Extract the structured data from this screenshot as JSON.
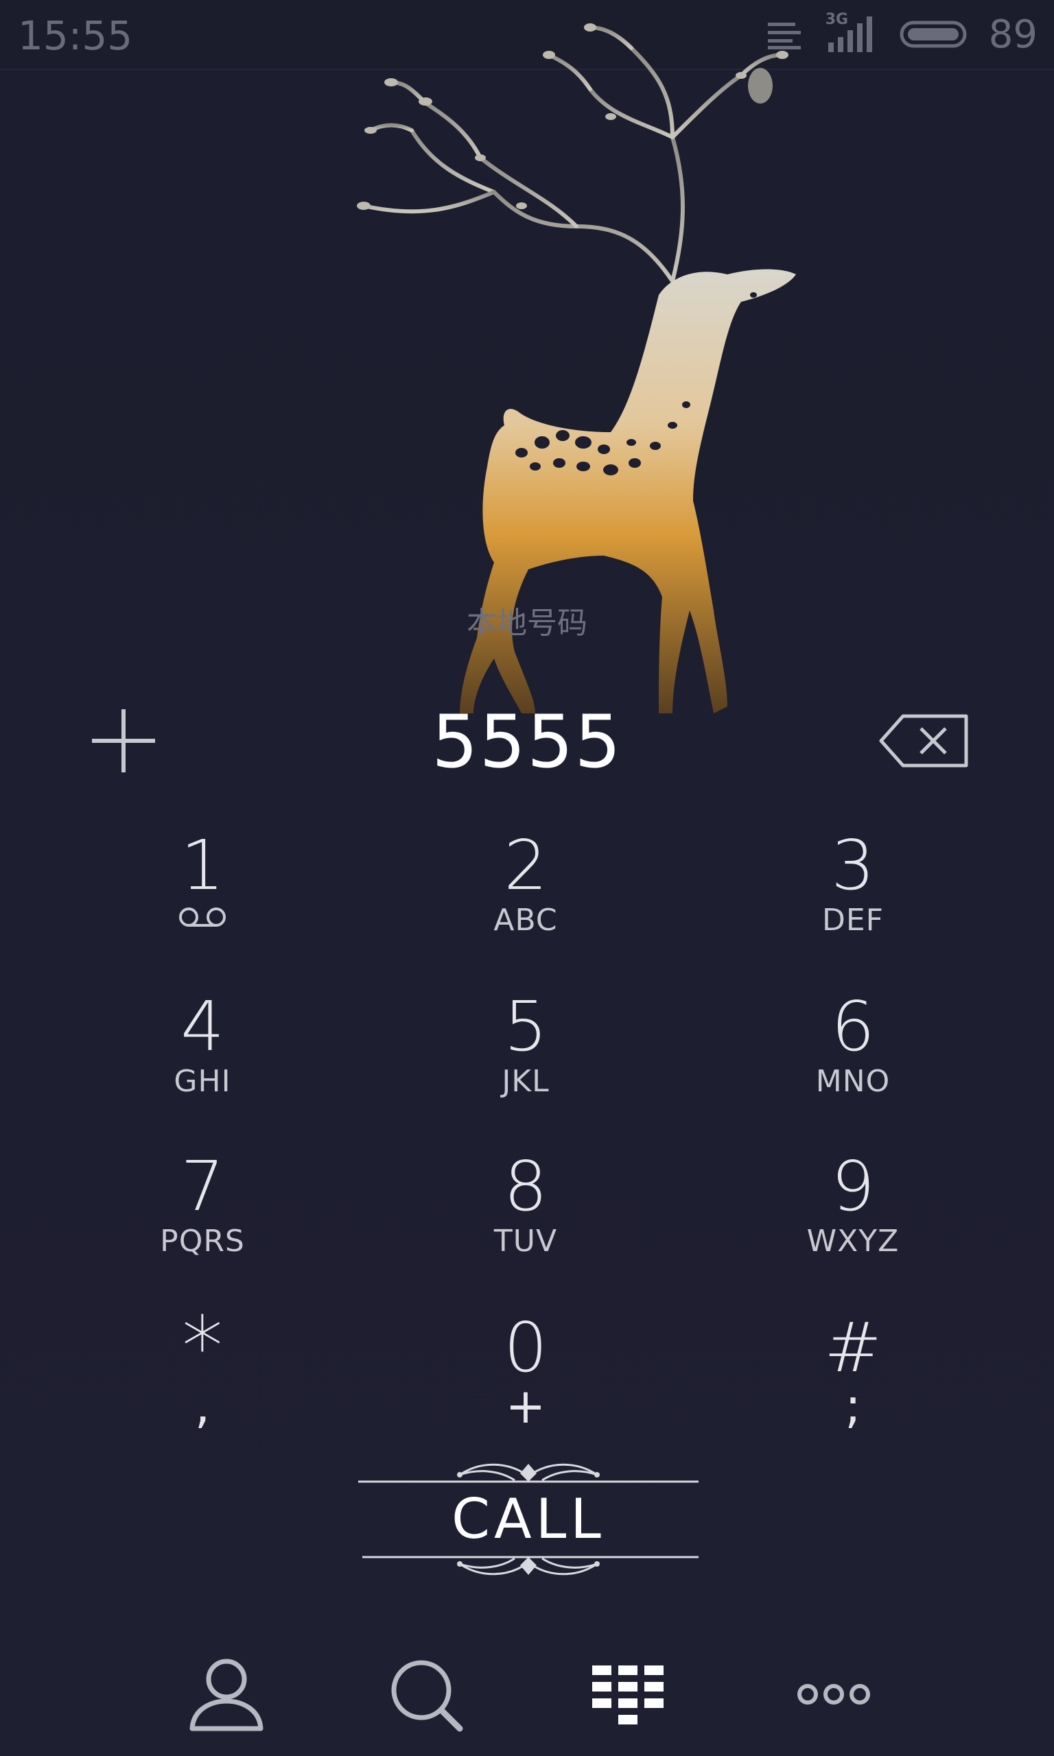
{
  "status_bar": {
    "time": "15:55",
    "network": "3G",
    "battery": "89"
  },
  "dialer": {
    "caller_location": "本地号码",
    "number": "5555"
  },
  "keypad": [
    {
      "digit": "1",
      "letters": "",
      "sub_icon": "voicemail-icon"
    },
    {
      "digit": "2",
      "letters": "ABC"
    },
    {
      "digit": "3",
      "letters": "DEF"
    },
    {
      "digit": "4",
      "letters": "GHI"
    },
    {
      "digit": "5",
      "letters": "JKL"
    },
    {
      "digit": "6",
      "letters": "MNO"
    },
    {
      "digit": "7",
      "letters": "PQRS"
    },
    {
      "digit": "8",
      "letters": "TUV"
    },
    {
      "digit": "9",
      "letters": "WXYZ"
    },
    {
      "digit": "*",
      "letters": ","
    },
    {
      "digit": "0",
      "letters": "+"
    },
    {
      "digit": "#",
      "letters": ";"
    }
  ],
  "call_button": {
    "label": "CALL"
  },
  "bottom_nav": [
    {
      "icon": "contacts-icon"
    },
    {
      "icon": "search-icon"
    },
    {
      "icon": "dialpad-icon",
      "active": true
    },
    {
      "icon": "more-icon"
    }
  ],
  "colors": {
    "background": "#1d1e2f",
    "text": "#e6e6ec",
    "secondary_text": "#6a6b7a",
    "wallpaper_gold": "#d89a3a"
  }
}
